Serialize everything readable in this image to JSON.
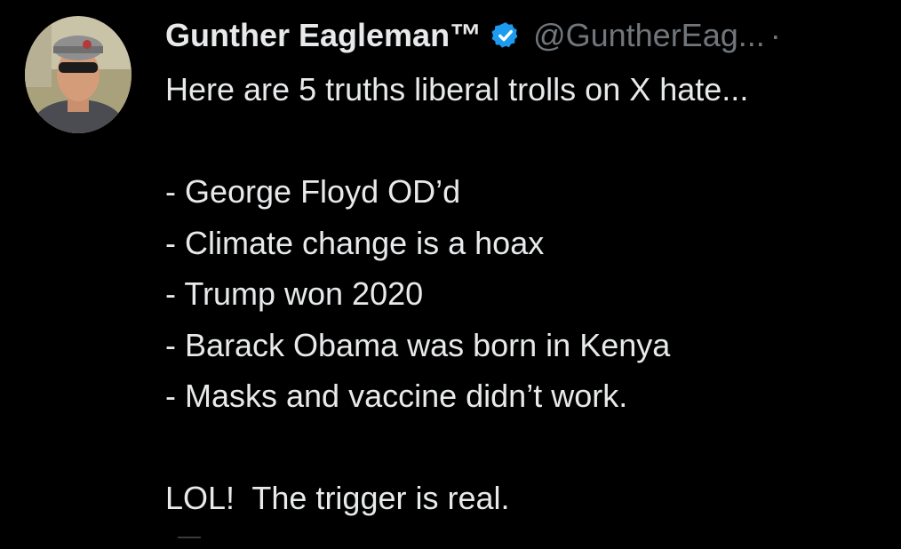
{
  "author": {
    "display_name": "Gunther Eagleman™",
    "handle": "@GuntherEag...",
    "separator": "·",
    "verified_color": "#1d9bf0"
  },
  "tweet": {
    "intro": "Here are 5 truths liberal trolls on X hate...",
    "items": [
      "- George Floyd OD’d",
      "- Climate change is a hoax",
      "- Trump won 2020",
      "- Barack Obama was born in Kenya",
      "- Masks and vaccine didn’t work."
    ],
    "closing": "LOL!  The trigger is real."
  }
}
